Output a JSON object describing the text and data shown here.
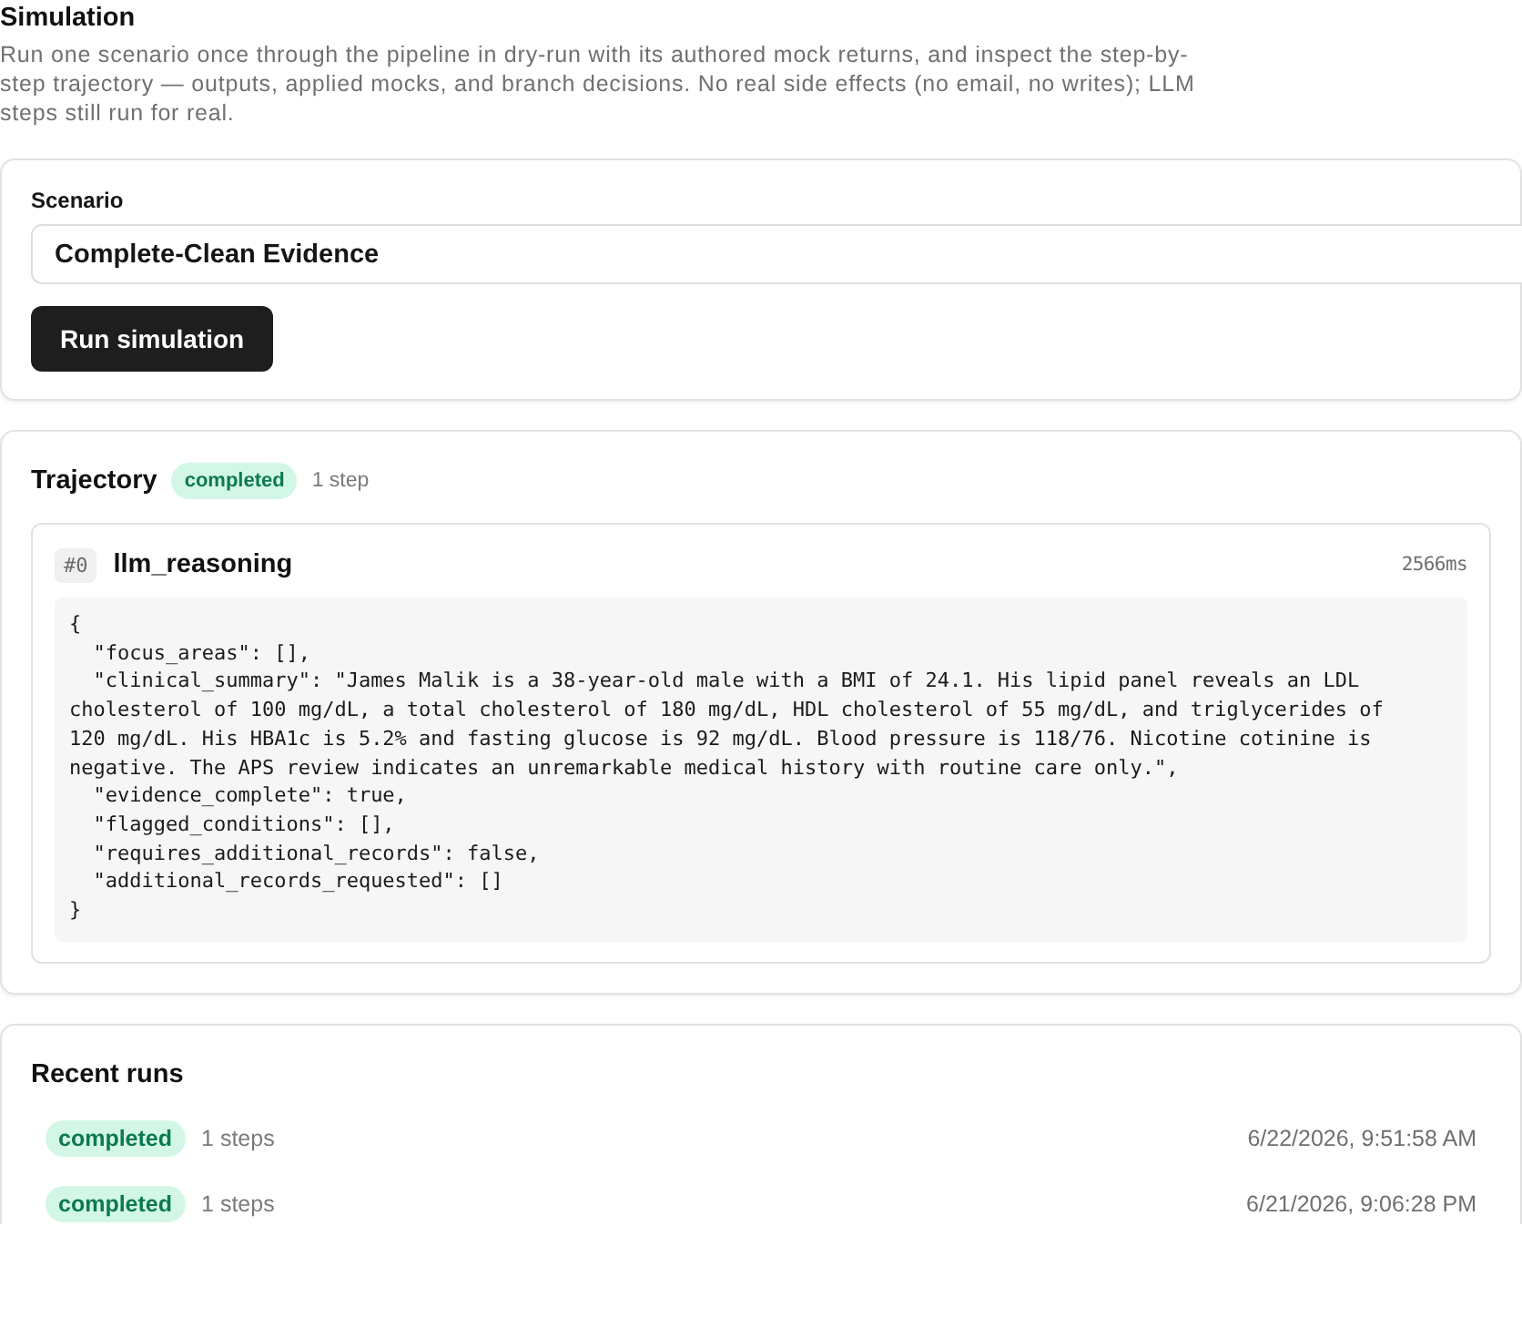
{
  "header": {
    "title": "Simulation",
    "description": "Run one scenario once through the pipeline in dry-run with its authored mock returns, and inspect the step-by-step trajectory — outputs, applied mocks, and branch decisions. No real side effects (no email, no writes); LLM steps still run for real."
  },
  "scenario_card": {
    "label": "Scenario",
    "value": "Complete-Clean Evidence",
    "run_button": "Run simulation"
  },
  "trajectory": {
    "title": "Trajectory",
    "status": {
      "label": "completed",
      "kind": "completed"
    },
    "step_count": "1 step",
    "steps": [
      {
        "index": "#0",
        "name": "llm_reasoning",
        "duration": "2566ms",
        "output_lines": [
          "{",
          "  \"focus_areas\": [],",
          "  \"clinical_summary\": \"James Malik is a 38-year-old male with a BMI of 24.1. His lipid panel reveals an LDL",
          "cholesterol of 100 mg/dL, a total cholesterol of 180 mg/dL, HDL cholesterol of 55 mg/dL, and triglycerides of",
          "120 mg/dL. His HBA1c is 5.2% and fasting glucose is 92 mg/dL. Blood pressure is 118/76. Nicotine cotinine is",
          "negative. The APS review indicates an unremarkable medical history with routine care only.\",",
          "  \"evidence_complete\": true,",
          "  \"flagged_conditions\": [],",
          "  \"requires_additional_records\": false,",
          "  \"additional_records_requested\": []",
          "}"
        ]
      }
    ]
  },
  "recent_runs": {
    "title": "Recent runs",
    "runs": [
      {
        "status": {
          "label": "completed",
          "kind": "completed"
        },
        "steps": "1 steps",
        "time": "6/22/2026, 9:51:58 AM"
      },
      {
        "status": {
          "label": "completed",
          "kind": "completed"
        },
        "steps": "1 steps",
        "time": "6/21/2026, 9:06:28 PM"
      }
    ]
  }
}
